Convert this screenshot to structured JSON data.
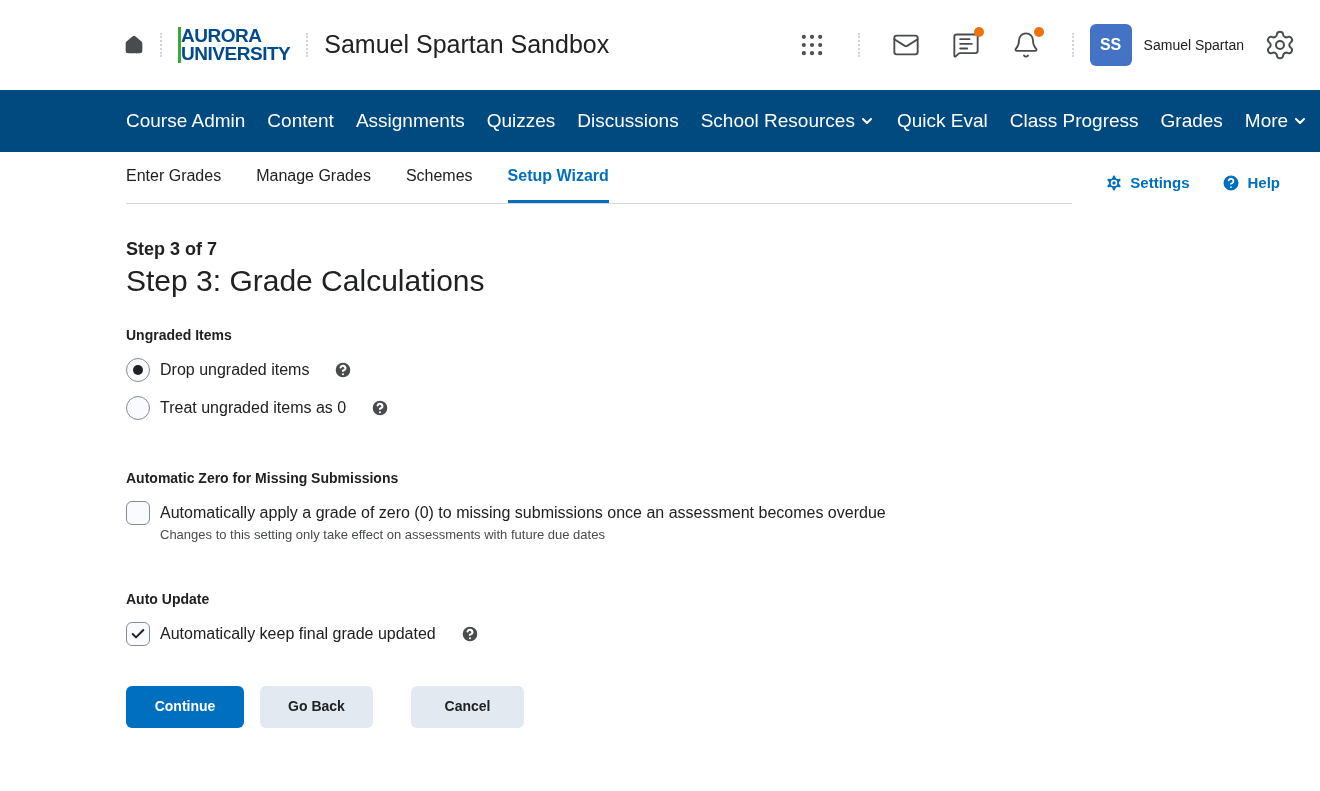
{
  "header": {
    "logo": [
      "AURORA",
      "UNIVERSITY"
    ],
    "course_title": "Samuel Spartan Sandbox",
    "tools": [
      {
        "kind": "grid",
        "alert": false
      },
      {
        "kind": "mail",
        "alert": false
      },
      {
        "kind": "chat",
        "alert": true
      },
      {
        "kind": "bell",
        "alert": true
      }
    ],
    "user": {
      "initials": "SS",
      "name": "Samuel Spartan"
    }
  },
  "nav": [
    {
      "label": "Course Admin",
      "dropdown": false
    },
    {
      "label": "Content",
      "dropdown": false
    },
    {
      "label": "Assignments",
      "dropdown": false
    },
    {
      "label": "Quizzes",
      "dropdown": false
    },
    {
      "label": "Discussions",
      "dropdown": false
    },
    {
      "label": "School Resources",
      "dropdown": true
    },
    {
      "label": "Quick Eval",
      "dropdown": false
    },
    {
      "label": "Class Progress",
      "dropdown": false
    },
    {
      "label": "Grades",
      "dropdown": false
    },
    {
      "label": "More",
      "dropdown": true
    }
  ],
  "tabs": [
    {
      "label": "Enter Grades",
      "selected": false
    },
    {
      "label": "Manage Grades",
      "selected": false
    },
    {
      "label": "Schemes",
      "selected": false
    },
    {
      "label": "Setup Wizard",
      "selected": true
    }
  ],
  "actions": [
    {
      "kind": "settings",
      "label": "Settings"
    },
    {
      "kind": "help",
      "label": "Help"
    }
  ],
  "step": "Step 3 of 7",
  "title": "Step 3: Grade Calculations",
  "sections": [
    {
      "heading": "Ungraded Items",
      "kind": "radio",
      "options": [
        {
          "label": "Drop ungraded items",
          "selected": true,
          "help": true
        },
        {
          "label": "Treat ungraded items as 0",
          "selected": false,
          "help": true
        }
      ]
    },
    {
      "heading": "Automatic Zero for Missing Submissions",
      "kind": "checkbox",
      "options": [
        {
          "label": "Automatically apply a grade of zero (0) to missing submissions once an assessment becomes overdue",
          "checked": false,
          "help": false,
          "note": "Changes to this setting only take effect on assessments with future due dates"
        }
      ]
    },
    {
      "heading": "Auto Update",
      "kind": "checkbox",
      "options": [
        {
          "label": "Automatically keep final grade updated",
          "checked": true,
          "help": true
        }
      ]
    }
  ],
  "buttons": [
    {
      "label": "Continue",
      "kind": "primary"
    },
    {
      "label": "Go Back",
      "kind": "secondary"
    },
    {
      "label": "Cancel",
      "kind": "secondary"
    }
  ]
}
